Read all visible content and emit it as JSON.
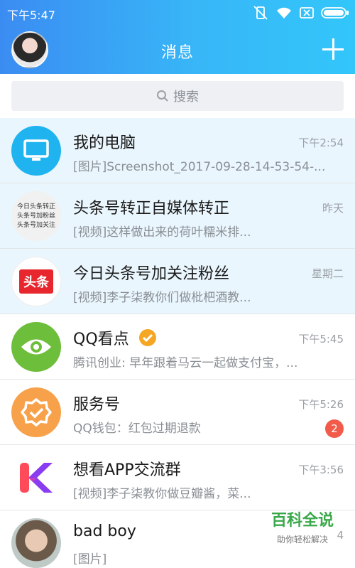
{
  "status_bar": {
    "time": "下午5:47"
  },
  "header": {
    "title": "消息"
  },
  "search": {
    "placeholder": "搜索"
  },
  "conversations": [
    {
      "name": "我的电脑",
      "preview": "[图片]Screenshot_2017-09-28-14-53-54-...",
      "time": "下午2:54",
      "pinned": true,
      "avatar_icon": "computer-monitor-icon"
    },
    {
      "name": "头条号转正自媒体转正",
      "preview": "[视频]这样做出来的荷叶糯米排...",
      "time": "昨天",
      "pinned": true,
      "avatar_text": [
        "今日头条转正",
        "头条号加粉丝",
        "头条号加关注"
      ]
    },
    {
      "name": "今日头条号加关注粉丝",
      "preview": "[视频]李子柒教你们做枇杷酒教...",
      "time": "星期二",
      "pinned": true,
      "avatar_text": "头条"
    },
    {
      "name": "QQ看点",
      "preview": "腾讯创业: 早年跟着马云一起做支付宝，...",
      "time": "下午5:45",
      "pinned": false,
      "avatar_icon": "eye-icon",
      "verified": true
    },
    {
      "name": "服务号",
      "preview": "QQ钱包：红包过期退款",
      "time": "下午5:26",
      "pinned": false,
      "avatar_icon": "badge-check-icon",
      "badge": "2"
    },
    {
      "name": "想看APP交流群",
      "preview": "[视频]李子柒教你做豆瓣酱，菜...",
      "time": "下午3:56",
      "pinned": false,
      "avatar_icon": "k-logo-icon"
    },
    {
      "name": "bad boy",
      "preview": "[图片]",
      "time": "4",
      "pinned": false,
      "avatar_icon": "photo-avatar"
    }
  ],
  "watermark": {
    "title": "百科全说",
    "subtitle": "助你轻松解决"
  },
  "colors": {
    "header_start": "#3b8cf2",
    "header_end": "#32c6fa",
    "pinned_bg": "#eaf6fd",
    "badge": "#f25a4a"
  }
}
